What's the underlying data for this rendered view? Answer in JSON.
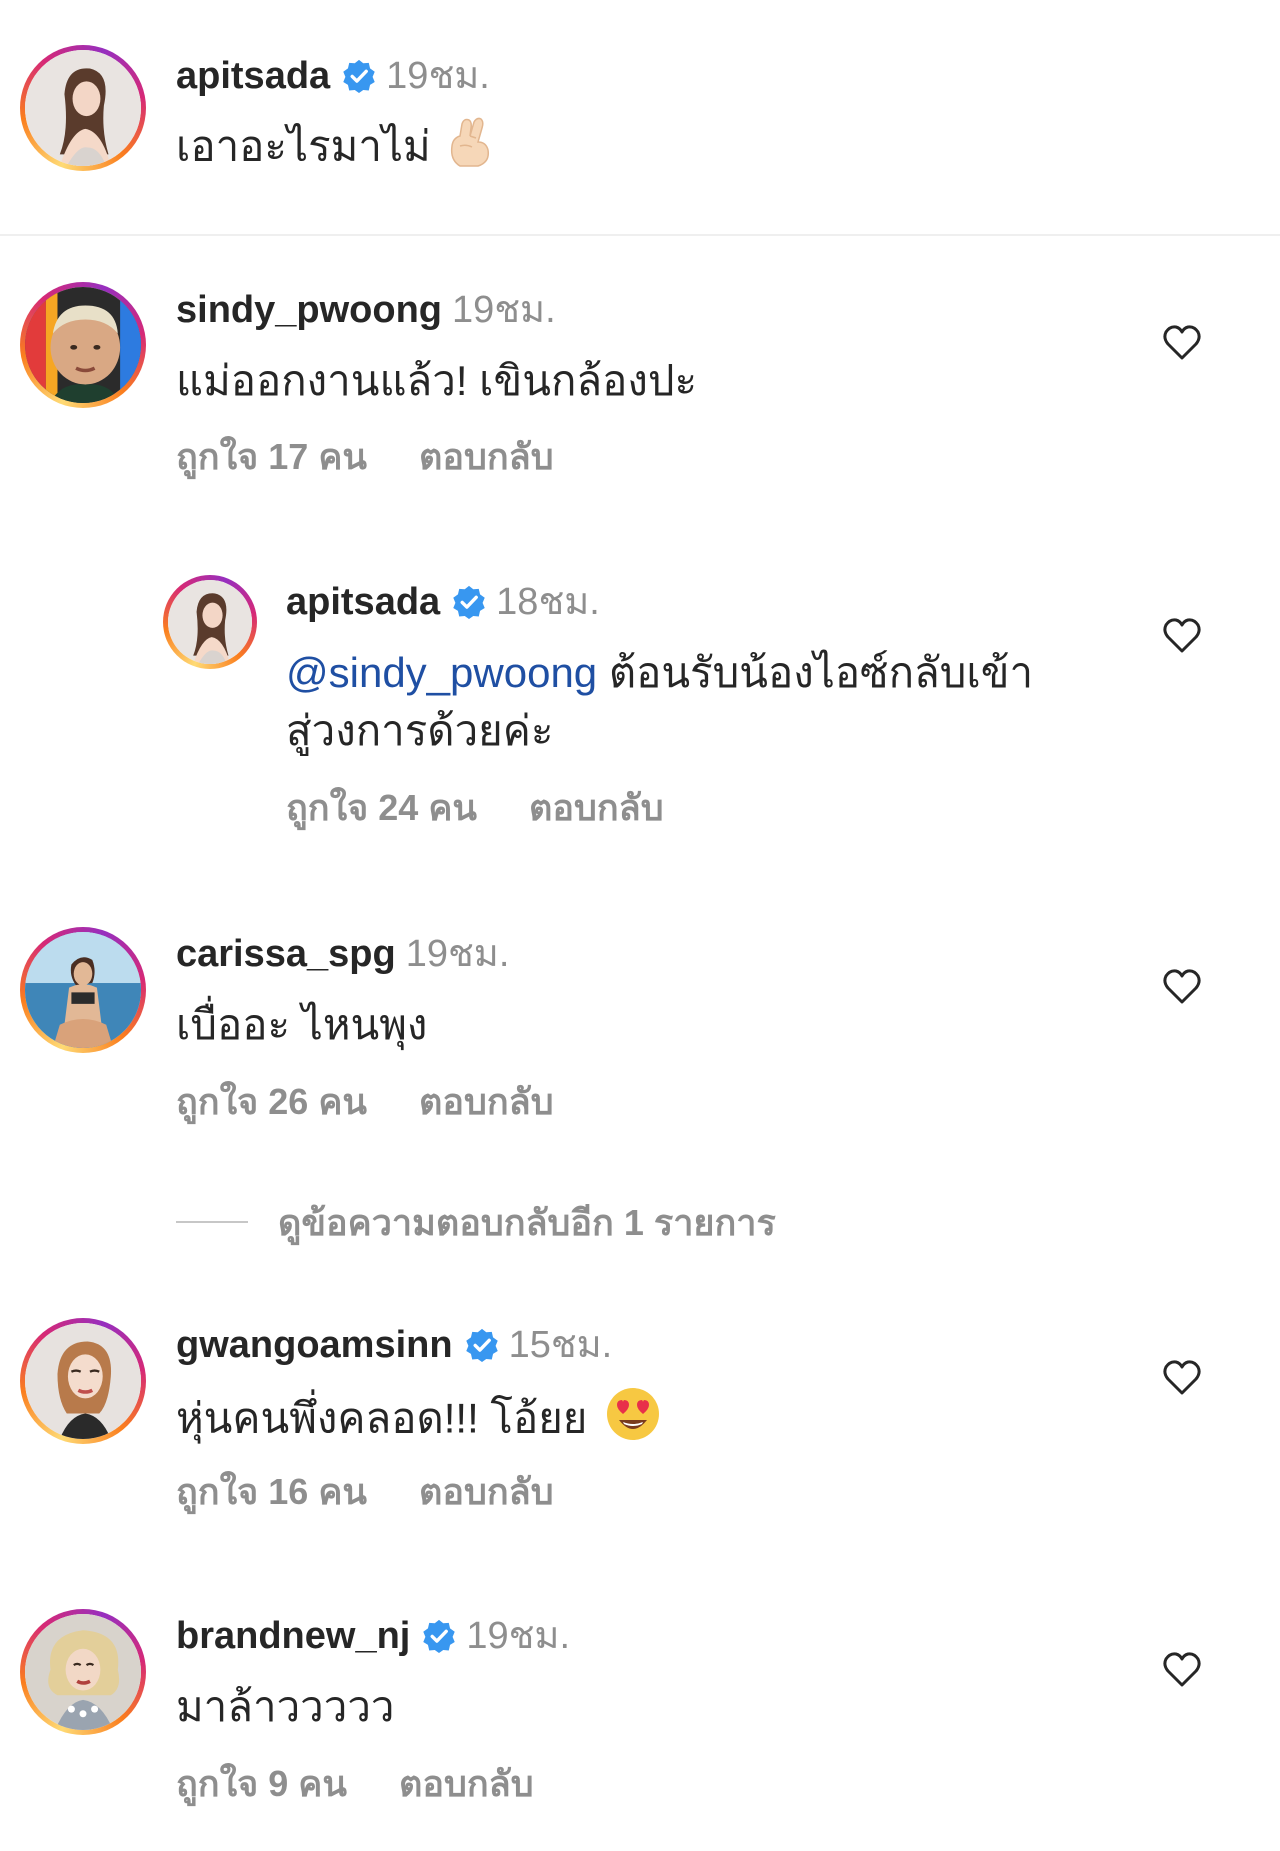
{
  "caption": {
    "username": "apitsada",
    "verified": true,
    "time": "19ชม.",
    "text": "เอาอะไรมาไม่",
    "emoji": "crossed-fingers"
  },
  "comments": [
    {
      "username": "sindy_pwoong",
      "verified": false,
      "time": "19ชม.",
      "text": "แม่ออกงานแล้ว! เขินกล้องปะ",
      "likes": "ถูกใจ 17 คน",
      "reply": "ตอบกลับ"
    },
    {
      "username": "apitsada",
      "verified": true,
      "time": "18ชม.",
      "mention": "@sindy_pwoong",
      "text_line1": " ต้อนรับน้องไอซ์กลับเข้า",
      "text_line2": "สู่วงการด้วยค่ะ",
      "likes": "ถูกใจ 24 คน",
      "reply": "ตอบกลับ"
    },
    {
      "username": "carissa_spg",
      "verified": false,
      "time": "19ชม.",
      "text": "เบื่ออะ ไหนพุง",
      "likes": "ถูกใจ 26 คน",
      "reply": "ตอบกลับ"
    },
    {
      "username": "gwangoamsinn",
      "verified": true,
      "time": "15ชม.",
      "text": "หุ่นคนพึ่งคลอด!!! โอ้ยย",
      "emoji": "heart-eyes",
      "likes": "ถูกใจ 16 คน",
      "reply": "ตอบกลับ"
    },
    {
      "username": "brandnew_nj",
      "verified": true,
      "time": "19ชม.",
      "text": "มาล้าววววว",
      "likes": "ถูกใจ 9 คน",
      "reply": "ตอบกลับ"
    }
  ],
  "view_replies": "ดูข้อความตอบกลับอีก 1 รายการ",
  "colors": {
    "verified_blue": "#3897f0",
    "mention_blue": "#1f4fa3",
    "muted": "#8e8e8e",
    "text": "#262626"
  }
}
